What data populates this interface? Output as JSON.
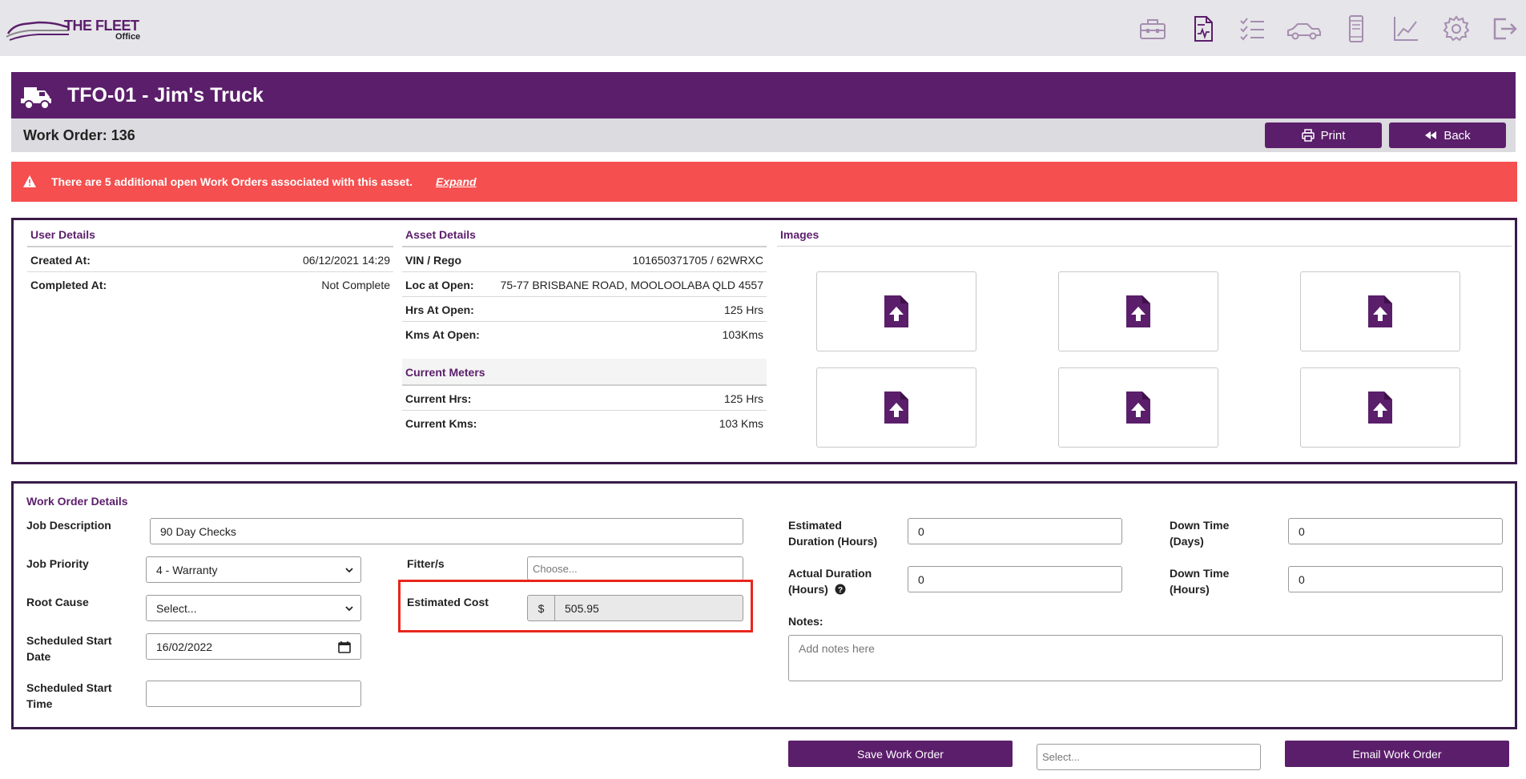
{
  "app": {
    "logo_title": "THE FLEET",
    "logo_sub": "Office"
  },
  "nav_icons": [
    "toolbox-icon",
    "report-icon",
    "checklist-icon",
    "vehicles-icon",
    "mobile-icon",
    "chart-icon",
    "settings-icon",
    "logout-icon"
  ],
  "header": {
    "asset_title": "TFO-01 - Jim's Truck",
    "work_order": "Work Order: 136",
    "print_label": "Print",
    "back_label": "Back"
  },
  "alert": {
    "text": "There are 5 additional open Work Orders associated with this asset.",
    "link": "Expand",
    "color": "#f54f4f"
  },
  "user_details": {
    "title": "User Details",
    "rows": [
      {
        "label": "Created At:",
        "value": "06/12/2021 14:29"
      },
      {
        "label": "Completed At:",
        "value": "Not Complete"
      }
    ]
  },
  "asset_details": {
    "title": "Asset Details",
    "rows": [
      {
        "label": "VIN / Rego",
        "value": "101650371705 / 62WRXC"
      },
      {
        "label": "Loc at Open:",
        "value": "75-77 BRISBANE ROAD, MOOLOOLABA QLD 4557"
      },
      {
        "label": "Hrs At Open:",
        "value": "125 Hrs"
      },
      {
        "label": "Kms At Open:",
        "value": "103Kms"
      }
    ],
    "meters_title": "Current Meters",
    "meters": [
      {
        "label": "Current Hrs:",
        "value": "125 Hrs"
      },
      {
        "label": "Current Kms:",
        "value": "103 Kms"
      }
    ]
  },
  "images": {
    "title": "Images"
  },
  "work_order_details": {
    "title": "Work Order Details",
    "job_description": {
      "label": "Job Description",
      "value": "90 Day Checks"
    },
    "job_priority": {
      "label": "Job Priority",
      "value": "4 - Warranty"
    },
    "root_cause": {
      "label": "Root Cause",
      "value": "Select..."
    },
    "scheduled_start_date": {
      "label": "Scheduled Start Date",
      "value": "16/02/2022"
    },
    "scheduled_start_time": {
      "label": "Scheduled Start Time",
      "value": ""
    },
    "fitters": {
      "label": "Fitter/s",
      "placeholder": "Choose..."
    },
    "estimated_cost": {
      "label": "Estimated Cost",
      "currency": "$",
      "value": "505.95"
    },
    "estimated_duration": {
      "label": "Estimated Duration (Hours)",
      "value": "0"
    },
    "actual_duration": {
      "label": "Actual Duration (Hours)",
      "value": "0"
    },
    "down_time_days": {
      "label": "Down Time (Days)",
      "value": "0"
    },
    "down_time_hours": {
      "label": "Down Time (Hours)",
      "value": "0"
    },
    "notes": {
      "label": "Notes:",
      "placeholder": "Add notes here"
    }
  },
  "footer": {
    "save_label": "Save Work Order",
    "select_placeholder": "Select...",
    "email_label": "Email Work Order"
  },
  "colors": {
    "brand": "#5b1e6b",
    "highlight": "#e8261c"
  }
}
